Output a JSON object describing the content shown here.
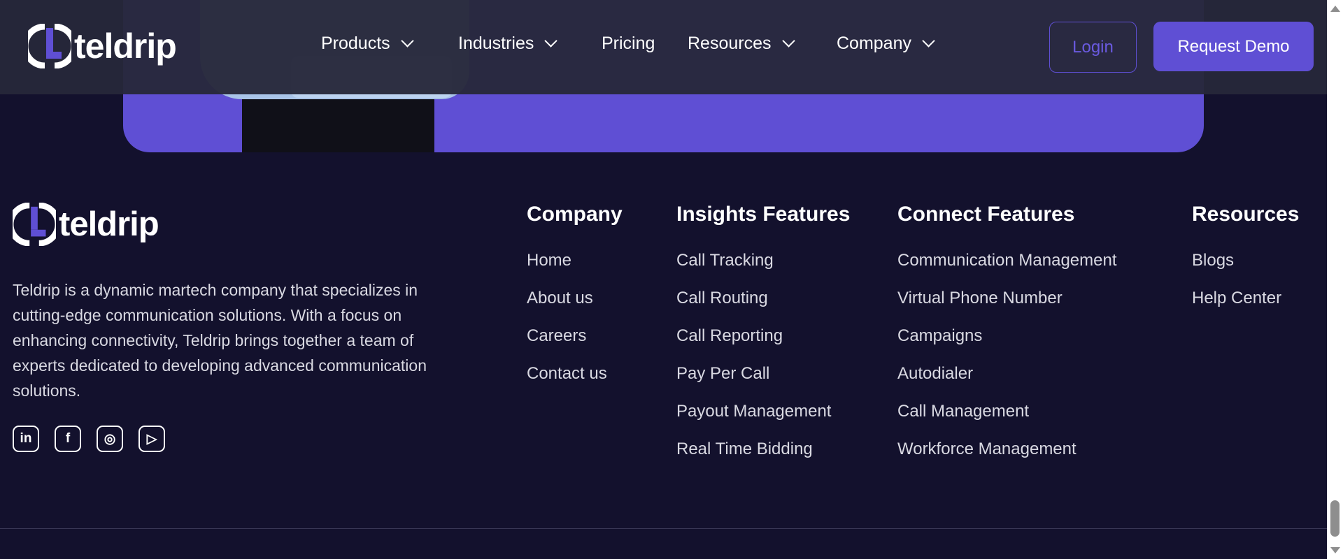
{
  "brand": {
    "name": "teldrip",
    "accent": "#5f4fd4",
    "background": "#13112d"
  },
  "header": {
    "nav": [
      {
        "label": "Products",
        "dropdown": true
      },
      {
        "label": "Industries",
        "dropdown": true
      },
      {
        "label": "Pricing",
        "dropdown": false
      },
      {
        "label": "Resources",
        "dropdown": true
      },
      {
        "label": "Company",
        "dropdown": true
      }
    ],
    "login_label": "Login",
    "demo_label": "Request Demo"
  },
  "footer": {
    "description": "Teldrip is a dynamic martech company that specializes in cutting-edge communication solutions. With a focus on enhancing connectivity, Teldrip brings together a team of experts dedicated to developing advanced communication solutions.",
    "social": [
      {
        "icon": "linkedin-icon",
        "glyph": "in"
      },
      {
        "icon": "facebook-icon",
        "glyph": "f"
      },
      {
        "icon": "instagram-icon",
        "glyph": "◎"
      },
      {
        "icon": "youtube-icon",
        "glyph": "▷"
      }
    ],
    "columns": [
      {
        "title": "Company",
        "items": [
          "Home",
          "About us",
          "Careers",
          "Contact us"
        ]
      },
      {
        "title": "Insights Features",
        "items": [
          "Call Tracking",
          "Call Routing",
          "Call Reporting",
          "Pay Per Call",
          "Payout Management",
          "Real Time Bidding"
        ]
      },
      {
        "title": "Connect Features",
        "items": [
          "Communication Management",
          "Virtual Phone Number",
          "Campaigns",
          "Autodialer",
          "Call Management",
          "Workforce Management"
        ]
      },
      {
        "title": "Resources",
        "items": [
          "Blogs",
          "Help Center"
        ]
      }
    ]
  }
}
